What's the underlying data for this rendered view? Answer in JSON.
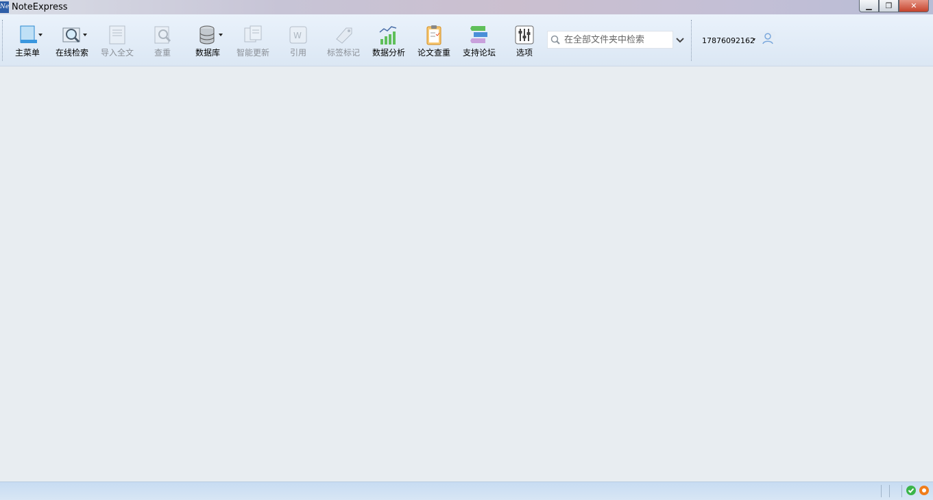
{
  "window": {
    "title": "NoteExpress",
    "app_icon_text": "Ne",
    "buttons": {
      "minimize": "▁",
      "restore": "❐",
      "close": "✕"
    }
  },
  "toolbar": {
    "main_menu": "主菜单",
    "online_search": "在线检索",
    "import_fulltext": "导入全文",
    "find_duplicates": "查重",
    "database": "数据库",
    "smart_update": "智能更新",
    "cite": "引用",
    "tag_mark": "标签标记",
    "data_analysis": "数据分析",
    "paper_check": "论文查重",
    "support_forum": "支持论坛",
    "options": "选项"
  },
  "search": {
    "placeholder": "在全部文件夹中检索",
    "value": ""
  },
  "user": {
    "id": "17876092162"
  },
  "colors": {
    "accent": "#2f5fa8",
    "status_ok": "#3bb54a",
    "status_alert": "#f07d1a"
  },
  "icons": {
    "main_menu": "window-icon",
    "online_search": "magnifier-icon",
    "database": "database-icon",
    "data_analysis": "bar-chart-icon",
    "paper_check": "clipboard-icon",
    "support_forum": "forum-icon",
    "options": "sliders-icon"
  }
}
